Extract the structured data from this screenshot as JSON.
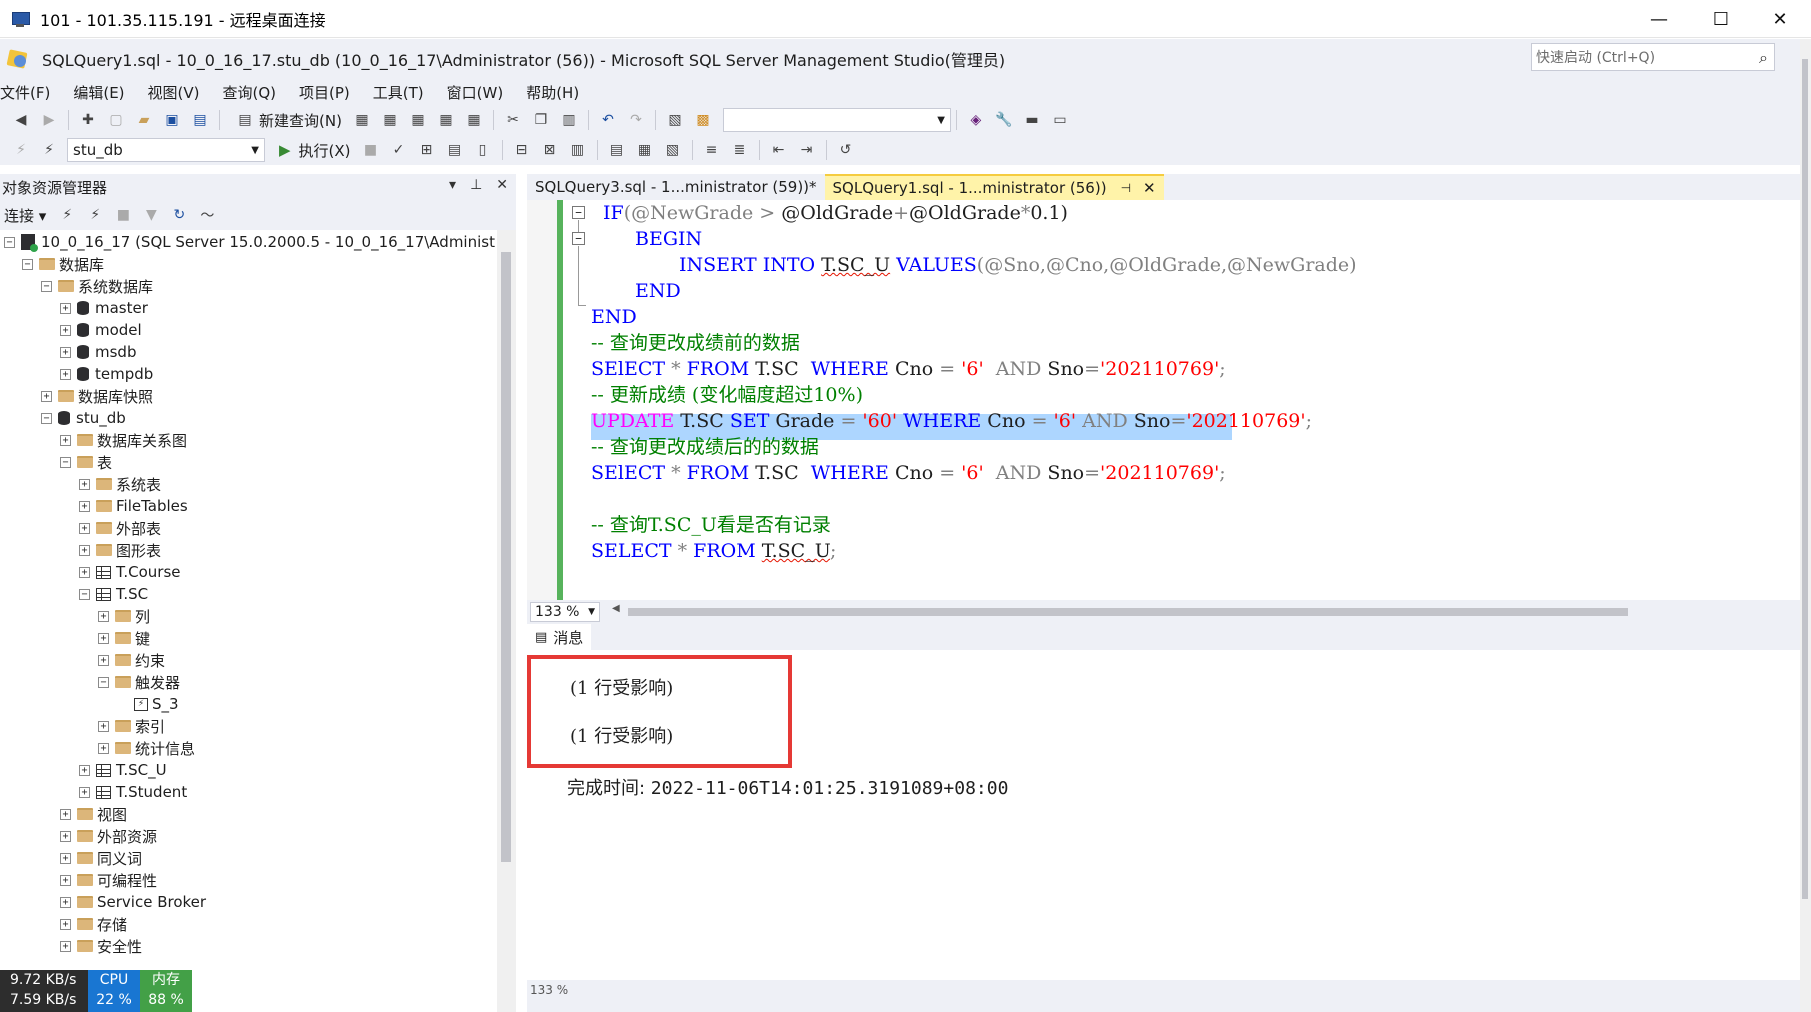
{
  "rdp": {
    "title": "101 - 101.35.115.191 - 远程桌面连接",
    "minimize": "—",
    "maximize": "☐",
    "close": "✕"
  },
  "ssms": {
    "title": "SQLQuery1.sql - 10_0_16_17.stu_db (10_0_16_17\\Administrator (56)) - Microsoft SQL Server Management Studio(管理员)",
    "quick_launch_placeholder": "快速启动 (Ctrl+Q)"
  },
  "menu": [
    "文件(F)",
    "编辑(E)",
    "视图(V)",
    "查询(Q)",
    "项目(P)",
    "工具(T)",
    "窗口(W)",
    "帮助(H)"
  ],
  "toolbar": {
    "new_query": "新建查询(N)",
    "database": "stu_db",
    "execute": "执行(X)"
  },
  "object_explorer": {
    "title": "对象资源管理器",
    "connect": "连接",
    "tree": [
      {
        "label": "10_0_16_17 (SQL Server 15.0.2000.5 - 10_0_16_17\\Administrato",
        "icon": "server-icon",
        "expander": "−"
      },
      {
        "label": "数据库",
        "icon": "folder-icon",
        "expander": "−"
      },
      {
        "label": "系统数据库",
        "icon": "folder-icon",
        "expander": "−"
      },
      {
        "label": "master",
        "icon": "database-icon",
        "expander": "+"
      },
      {
        "label": "model",
        "icon": "database-icon",
        "expander": "+"
      },
      {
        "label": "msdb",
        "icon": "database-icon",
        "expander": "+"
      },
      {
        "label": "tempdb",
        "icon": "database-icon",
        "expander": "+"
      },
      {
        "label": "数据库快照",
        "icon": "folder-icon",
        "expander": "+"
      },
      {
        "label": "stu_db",
        "icon": "database-icon",
        "expander": "−"
      },
      {
        "label": "数据库关系图",
        "icon": "folder-icon",
        "expander": "+"
      },
      {
        "label": "表",
        "icon": "folder-icon",
        "expander": "−"
      },
      {
        "label": "系统表",
        "icon": "folder-icon",
        "expander": "+"
      },
      {
        "label": "FileTables",
        "icon": "folder-icon",
        "expander": "+"
      },
      {
        "label": "外部表",
        "icon": "folder-icon",
        "expander": "+"
      },
      {
        "label": "图形表",
        "icon": "folder-icon",
        "expander": "+"
      },
      {
        "label": "T.Course",
        "icon": "table-icon",
        "expander": "+"
      },
      {
        "label": "T.SC",
        "icon": "table-icon",
        "expander": "−"
      },
      {
        "label": "列",
        "icon": "folder-icon",
        "expander": "+"
      },
      {
        "label": "键",
        "icon": "folder-icon",
        "expander": "+"
      },
      {
        "label": "约束",
        "icon": "folder-icon",
        "expander": "+"
      },
      {
        "label": "触发器",
        "icon": "folder-icon",
        "expander": "−"
      },
      {
        "label": "S_3",
        "icon": "trigger-icon",
        "expander": ""
      },
      {
        "label": "索引",
        "icon": "folder-icon",
        "expander": "+"
      },
      {
        "label": "统计信息",
        "icon": "folder-icon",
        "expander": "+"
      },
      {
        "label": "T.SC_U",
        "icon": "table-icon",
        "expander": "+"
      },
      {
        "label": "T.Student",
        "icon": "table-icon",
        "expander": "+"
      },
      {
        "label": "视图",
        "icon": "folder-icon",
        "expander": "+"
      },
      {
        "label": "外部资源",
        "icon": "folder-icon",
        "expander": "+"
      },
      {
        "label": "同义词",
        "icon": "folder-icon",
        "expander": "+"
      },
      {
        "label": "可编程性",
        "icon": "folder-icon",
        "expander": "+"
      },
      {
        "label": "Service Broker",
        "icon": "folder-icon",
        "expander": "+"
      },
      {
        "label": "存储",
        "icon": "folder-icon",
        "expander": "+"
      },
      {
        "label": "安全性",
        "icon": "folder-icon",
        "expander": "+"
      }
    ]
  },
  "tabs": [
    {
      "label": "SQLQuery3.sql - 1...ministrator (59))*"
    },
    {
      "label": "SQLQuery1.sql - 1...ministrator (56))"
    }
  ],
  "code": [
    {
      "kind": "if",
      "t1": "IF",
      "t2": "(@NewGrade ",
      "t3": ">",
      "t4": " @OldGrade",
      "t5": "+",
      "t6": "@OldGrade",
      "t7": "*",
      "t8": "0.1)"
    },
    {
      "kind": "kw",
      "text": "BEGIN"
    },
    {
      "kind": "insert",
      "t1": "INSERT INTO ",
      "t2": "T.SC_U",
      "t3": " VALUES",
      "t4": "(@Sno,@Cno,@OldGrade,@NewGrade)"
    },
    {
      "kind": "kw",
      "text": "END"
    },
    {
      "kind": "kw",
      "text": "END"
    },
    {
      "kind": "cm",
      "text": "-- 查询更改成绩前的数据"
    },
    {
      "kind": "select",
      "t1": "SElECT ",
      "t2": "*",
      "t3": " FROM ",
      "t4": "T.SC",
      "t5": "  WHERE ",
      "t6": "Cno ",
      "t7": "=",
      "t8": " '6'",
      "t9": "  AND ",
      "t10": "Sno",
      "t11": "=",
      "t12": "'202110769'",
      "t13": ";"
    },
    {
      "kind": "cm",
      "text": "-- 更新成绩 (变化幅度超过10%)"
    },
    {
      "kind": "update",
      "t1": "UPDATE ",
      "t2": "T.SC ",
      "t3": "SET ",
      "t4": "Grade ",
      "t5": "=",
      "t6": " '60'",
      "t7": " WHERE ",
      "t8": "Cno ",
      "t9": "=",
      "t10": " '6'",
      "t11": " AND ",
      "t12": "Sno",
      "t13": "=",
      "t14": "'202110769'",
      "t15": ";"
    },
    {
      "kind": "cm",
      "text": "-- 查询更改成绩后的的数据"
    },
    {
      "kind": "select",
      "t1": "SElECT ",
      "t2": "*",
      "t3": " FROM ",
      "t4": "T.SC",
      "t5": "  WHERE ",
      "t6": "Cno ",
      "t7": "=",
      "t8": " '6'",
      "t9": "  AND ",
      "t10": "Sno",
      "t11": "=",
      "t12": "'202110769'",
      "t13": ";"
    },
    {
      "kind": "blank",
      "text": ""
    },
    {
      "kind": "cm",
      "text": "-- 查询T.SC_U看是否有记录"
    },
    {
      "kind": "select2",
      "t1": "SELECT ",
      "t2": "*",
      "t3": " FROM ",
      "t4": "T.SC_U",
      "t5": ";"
    }
  ],
  "editor": {
    "zoom": "133 %"
  },
  "results": {
    "tab_label": "消息",
    "messages": [
      "(1 行受影响)",
      "(1 行受影响)"
    ],
    "completion_label": "完成时间: ",
    "completion_time": "2022-11-06T14:01:25.3191089+08:00",
    "zoom": "133 %"
  },
  "net_widget": {
    "up": "9.72 KB/s",
    "down": "7.59 KB/s",
    "cpu_label": "CPU",
    "cpu_value": "22 %",
    "mem_label": "内存",
    "mem_value": "88 %"
  }
}
